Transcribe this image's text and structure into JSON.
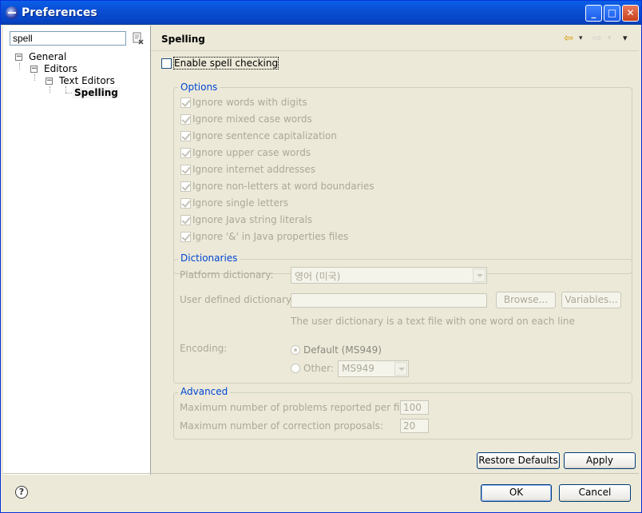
{
  "window": {
    "title": "Preferences",
    "minimize": "_",
    "maximize": "□",
    "close": "✕"
  },
  "filter": {
    "value": "spell"
  },
  "tree": {
    "nodes": [
      {
        "label": "General",
        "expander": "−"
      },
      {
        "label": "Editors",
        "expander": "−"
      },
      {
        "label": "Text Editors",
        "expander": "−"
      },
      {
        "label": "Spelling"
      }
    ]
  },
  "page": {
    "title": "Spelling",
    "nav_back": "⇦",
    "nav_forward": "⇨",
    "menu": "▾",
    "enable_spell": "Enable spell checking",
    "options": {
      "title": "Options",
      "items": [
        "Ignore words with digits",
        "Ignore mixed case words",
        "Ignore sentence capitalization",
        "Ignore upper case words",
        "Ignore internet addresses",
        "Ignore non-letters at word boundaries",
        "Ignore single letters",
        "Ignore Java string literals",
        "Ignore '&' in Java properties files"
      ]
    },
    "dictionaries": {
      "title": "Dictionaries",
      "platform_label": "Platform dictionary:",
      "platform_value": "영어 (미국)",
      "user_label": "User defined dictionary:",
      "browse": "Browse...",
      "variables": "Variables...",
      "hint": "The user dictionary is a text file with one word on each line",
      "encoding_label": "Encoding:",
      "default_label": "Default (MS949)",
      "other_label": "Other:",
      "other_value": "MS949"
    },
    "advanced": {
      "title": "Advanced",
      "max_problems_label": "Maximum number of problems reported per file:",
      "max_problems_value": "100",
      "max_proposals_label": "Maximum number of correction proposals:",
      "max_proposals_value": "20"
    },
    "restore_defaults": "Restore Defaults",
    "apply": "Apply"
  },
  "footer": {
    "help": "?",
    "ok": "OK",
    "cancel": "Cancel"
  }
}
